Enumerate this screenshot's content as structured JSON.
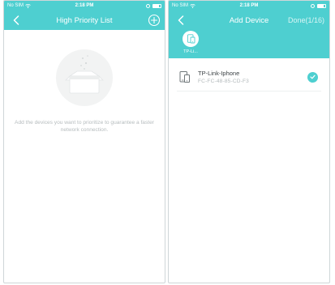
{
  "left_screen": {
    "status_bar": {
      "carrier": "No SIM",
      "time": "2:18 PM"
    },
    "nav": {
      "title": "High Priority List",
      "back_icon": "chevron-left-icon",
      "add_icon": "plus-circle-icon"
    },
    "empty_state": {
      "illustration": "empty-box-icon",
      "text": "Add the devices you want to prioritize to guarantee a faster network connection."
    }
  },
  "right_screen": {
    "status_bar": {
      "carrier": "No SIM",
      "time": "2:18 PM"
    },
    "nav": {
      "title": "Add Device",
      "done_label": "Done(1/16)",
      "back_icon": "chevron-left-icon"
    },
    "selected_devices": [
      {
        "label": "TP-Li...",
        "icon": "phone-device-icon"
      }
    ],
    "devices": [
      {
        "name": "TP-Link-Iphone",
        "mac": "FC-FC-48-85-CD-F3",
        "icon": "phone-device-icon",
        "selected": true
      }
    ]
  },
  "colors": {
    "accent": "#4ecfd0",
    "muted_text": "#b6bcbe",
    "device_text": "#3b4144"
  }
}
